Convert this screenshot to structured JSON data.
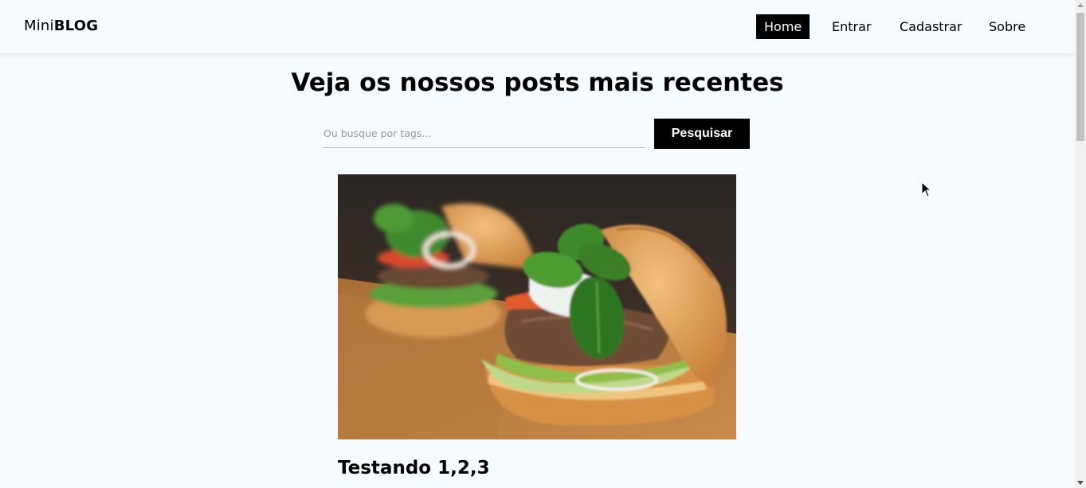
{
  "brand": {
    "prefix": "Mini",
    "bold": "BLOG"
  },
  "nav": {
    "items": [
      {
        "label": "Home",
        "active": true
      },
      {
        "label": "Entrar",
        "active": false
      },
      {
        "label": "Cadastrar",
        "active": false
      },
      {
        "label": "Sobre",
        "active": false
      }
    ]
  },
  "main": {
    "title": "Veja os nossos posts mais recentes",
    "search": {
      "placeholder": "Ou busque por tags...",
      "value": "",
      "button_label": "Pesquisar"
    }
  },
  "posts": [
    {
      "title": "Testando 1,2,3",
      "image_alt": "hamburger-photo"
    }
  ],
  "colors": {
    "background": "#f6fbff",
    "accent": "#000000",
    "accent_text": "#ffffff"
  }
}
